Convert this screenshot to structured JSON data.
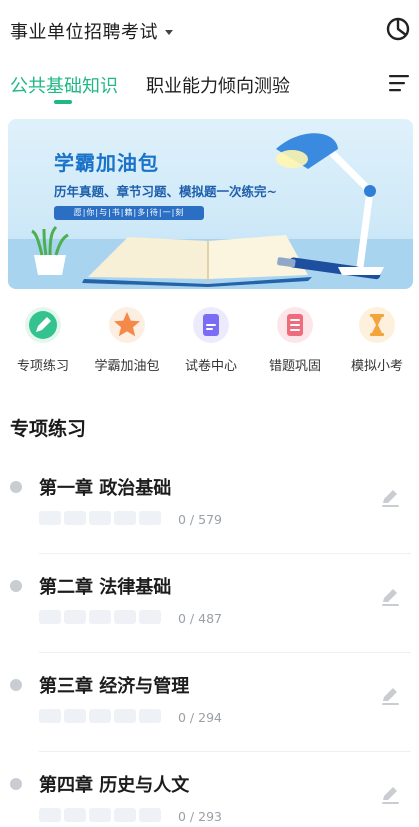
{
  "header": {
    "exam_title": "事业单位招聘考试",
    "stats_icon": "pie-chart-icon"
  },
  "tabs": [
    {
      "label": "公共基础知识",
      "active": true
    },
    {
      "label": "职业能力倾向测验",
      "active": false
    }
  ],
  "menu_icon": "menu-lines-icon",
  "banner": {
    "title": "学霸加油包",
    "subtitle": "历年真题、章节习题、模拟题一次练完~",
    "tag": "愿|你|与|书|籍|多|待|一|刻"
  },
  "shortcuts": [
    {
      "label": "专项练习",
      "icon": "pencil-icon",
      "color": "#34c38f"
    },
    {
      "label": "学霸加油包",
      "icon": "star-icon",
      "color": "#f5894a"
    },
    {
      "label": "试卷中心",
      "icon": "paper-icon",
      "color": "#7b6cf6"
    },
    {
      "label": "错题巩固",
      "icon": "notebook-icon",
      "color": "#f06b7b"
    },
    {
      "label": "模拟小考",
      "icon": "hourglass-icon",
      "color": "#f3a43c"
    }
  ],
  "section": {
    "title": "专项练习"
  },
  "chapters": [
    {
      "title": "第一章 政治基础",
      "progress": "0 / 579"
    },
    {
      "title": "第二章 法律基础",
      "progress": "0 / 487"
    },
    {
      "title": "第三章 经济与管理",
      "progress": "0 / 294"
    },
    {
      "title": "第四章 历史与人文",
      "progress": "0 / 293"
    }
  ],
  "colors": {
    "accent": "#1fb886"
  }
}
